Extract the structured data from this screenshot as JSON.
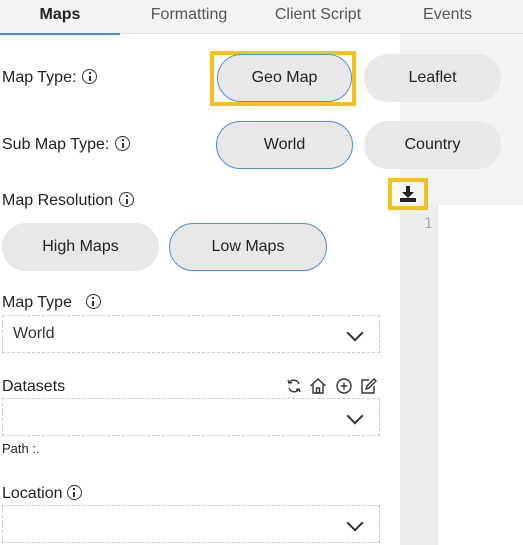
{
  "tabs": [
    {
      "label": "Maps",
      "active": true
    },
    {
      "label": "Formatting",
      "active": false
    },
    {
      "label": "Client Script",
      "active": false
    },
    {
      "label": "Events",
      "active": false
    }
  ],
  "map_type_row": {
    "label": "Map Type:",
    "options": [
      "Geo Map",
      "Leaflet"
    ],
    "selected": "Geo Map"
  },
  "sub_map_type_row": {
    "label": "Sub Map Type:",
    "options": [
      "World",
      "Country"
    ],
    "selected": "World"
  },
  "map_resolution": {
    "label": "Map Resolution",
    "options": [
      "High Maps",
      "Low Maps"
    ],
    "selected": "Low Maps"
  },
  "map_type_select": {
    "label": "Map Type",
    "value": "World"
  },
  "datasets": {
    "label": "Datasets",
    "value": "",
    "path_label": "Path :."
  },
  "location": {
    "label": "Location",
    "value": ""
  },
  "editor": {
    "line_number": "1"
  },
  "colors": {
    "accent": "#4a8fd9",
    "highlight": "#f5c21b",
    "pill_bg": "#e8e8e8"
  }
}
